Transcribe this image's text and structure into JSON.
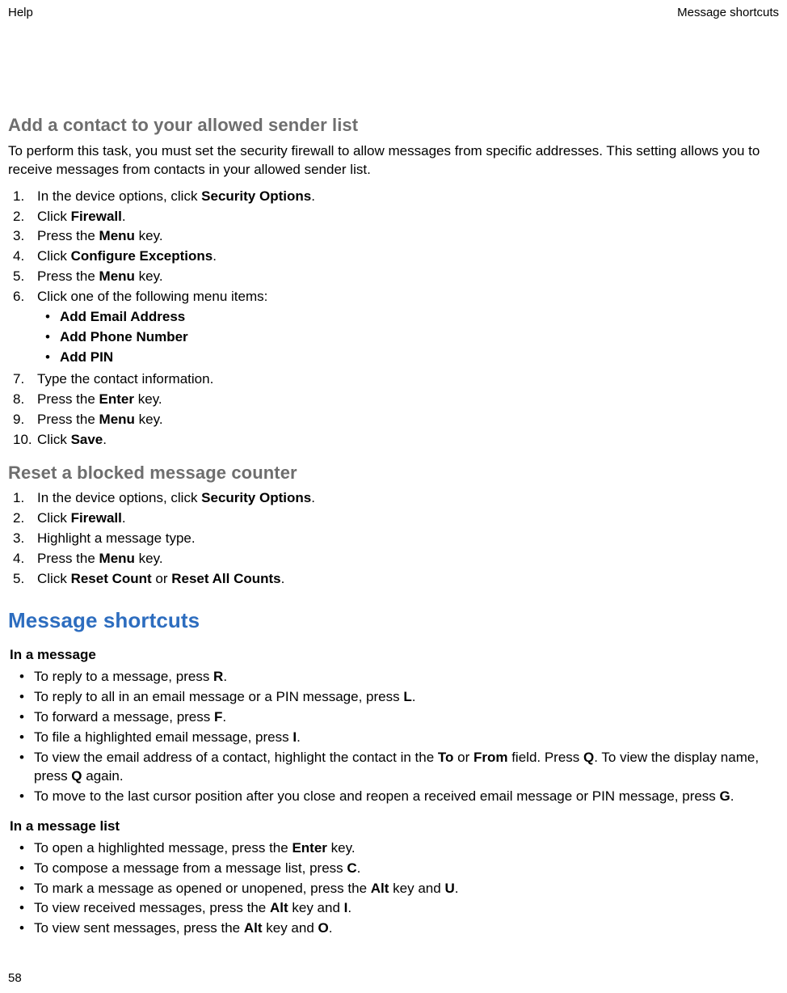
{
  "header": {
    "left": "Help",
    "right": "Message shortcuts"
  },
  "page_number": "58",
  "s1": {
    "title": "Add a contact to your allowed sender list",
    "intro": "To perform this task, you must set the security firewall to allow messages from specific addresses. This setting allows you to receive messages from contacts in your allowed sender list.",
    "steps": {
      "i1_a": "In the device options, click ",
      "i1_b": "Security Options",
      "i2_a": "Click ",
      "i2_b": "Firewall",
      "i3_a": "Press the ",
      "i3_b": "Menu",
      "i3_c": " key.",
      "i4_a": "Click ",
      "i4_b": "Configure Exceptions",
      "i5_a": "Press the ",
      "i5_b": "Menu",
      "i5_c": " key.",
      "i6": "Click one of the following menu items:",
      "i6_sub": {
        "a": "Add Email Address",
        "b": "Add Phone Number",
        "c": "Add PIN"
      },
      "i7": "Type the contact information.",
      "i8_a": "Press the ",
      "i8_b": "Enter",
      "i8_c": " key.",
      "i9_a": "Press the ",
      "i9_b": "Menu",
      "i9_c": " key.",
      "i10_a": "Click ",
      "i10_b": "Save"
    }
  },
  "s2": {
    "title": "Reset a blocked message counter",
    "steps": {
      "i1_a": "In the device options, click ",
      "i1_b": "Security Options",
      "i2_a": "Click ",
      "i2_b": "Firewall",
      "i3": "Highlight a message type.",
      "i4_a": "Press the ",
      "i4_b": "Menu",
      "i4_c": " key.",
      "i5_a": "Click ",
      "i5_b": "Reset Count",
      "i5_c": " or ",
      "i5_d": "Reset All Counts"
    }
  },
  "s3": {
    "title": "Message shortcuts",
    "g1": {
      "head": "In a message",
      "i1_a": "To reply to a message, press ",
      "i1_b": "R",
      "i2_a": "To reply to all in an email message or a PIN message, press ",
      "i2_b": "L",
      "i3_a": "To forward a message, press ",
      "i3_b": "F",
      "i4_a": "To file a highlighted email message, press ",
      "i4_b": "I",
      "i5_a": "To view the email address of a contact, highlight the contact in the ",
      "i5_b": "To",
      "i5_c": " or ",
      "i5_d": "From",
      "i5_e": " field. Press ",
      "i5_f": "Q",
      "i5_g": ". To view the display name, press ",
      "i5_h": "Q",
      "i5_i": " again.",
      "i6_a": "To move to the last cursor position after you close and reopen a received email message or PIN message, press ",
      "i6_b": "G"
    },
    "g2": {
      "head": "In a message list",
      "i1_a": "To open a highlighted message, press the ",
      "i1_b": "Enter",
      "i1_c": " key.",
      "i2_a": "To compose a message from a message list, press ",
      "i2_b": "C",
      "i3_a": "To mark a message as opened or unopened, press the ",
      "i3_b": "Alt",
      "i3_c": " key and ",
      "i3_d": "U",
      "i4_a": "To view received messages, press the ",
      "i4_b": "Alt",
      "i4_c": " key and ",
      "i4_d": "I",
      "i5_a": "To view sent messages, press the ",
      "i5_b": "Alt",
      "i5_c": " key and ",
      "i5_d": "O"
    }
  }
}
